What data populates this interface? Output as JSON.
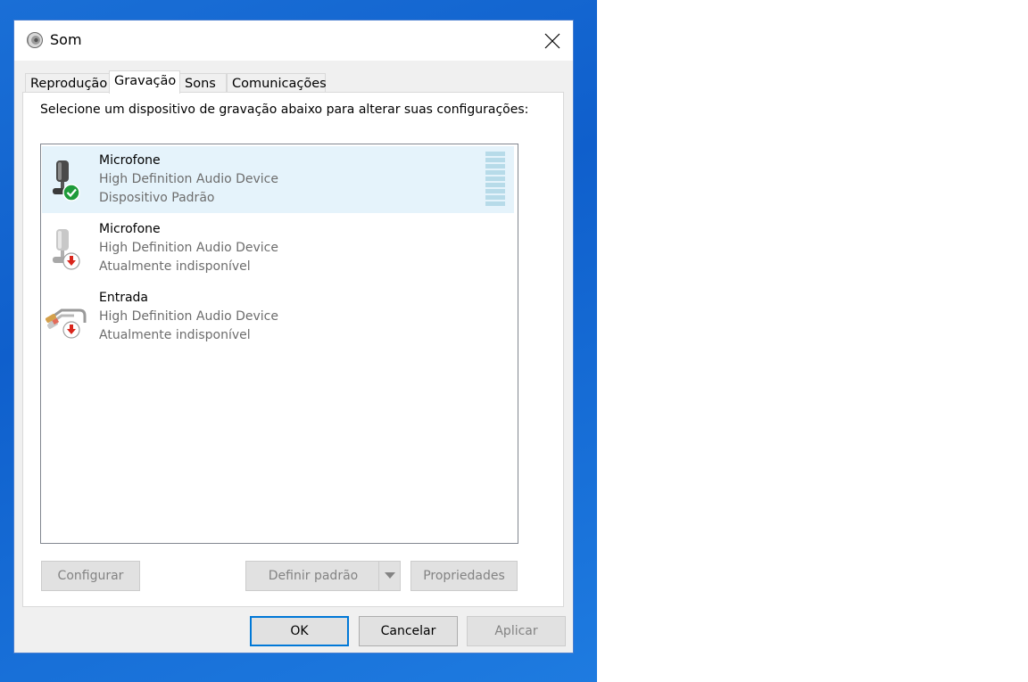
{
  "window": {
    "title": "Som",
    "title_icon": "speaker-icon"
  },
  "tabs": [
    {
      "label": "Reprodução",
      "active": false
    },
    {
      "label": "Gravação",
      "active": true
    },
    {
      "label": "Sons",
      "active": false
    },
    {
      "label": "Comunicações",
      "active": false
    }
  ],
  "panel": {
    "instruction": "Selecione um dispositivo de gravação abaixo para alterar suas configurações:"
  },
  "devices": [
    {
      "name": "Microfone",
      "description": "High Definition Audio Device",
      "status": "Dispositivo Padrão",
      "icon": "microphone-icon",
      "badge": "default-check-badge",
      "selected": true
    },
    {
      "name": "Microfone",
      "description": "High Definition Audio Device",
      "status": "Atualmente indisponível",
      "icon": "microphone-icon",
      "badge": "unavailable-arrow-badge",
      "selected": false
    },
    {
      "name": "Entrada",
      "description": "High Definition Audio Device",
      "status": "Atualmente indisponível",
      "icon": "line-in-cable-icon",
      "badge": "unavailable-arrow-badge",
      "selected": false
    }
  ],
  "panel_buttons": {
    "configure": "Configurar",
    "set_default": "Definir padrão",
    "properties": "Propriedades"
  },
  "dialog_buttons": {
    "ok": "OK",
    "cancel": "Cancelar",
    "apply": "Aplicar"
  },
  "colors": {
    "accent": "#0078d7",
    "selection": "#e5f3fb",
    "desktop": "#0f5fcc",
    "success": "#1e9b3a",
    "error": "#d9261c"
  }
}
